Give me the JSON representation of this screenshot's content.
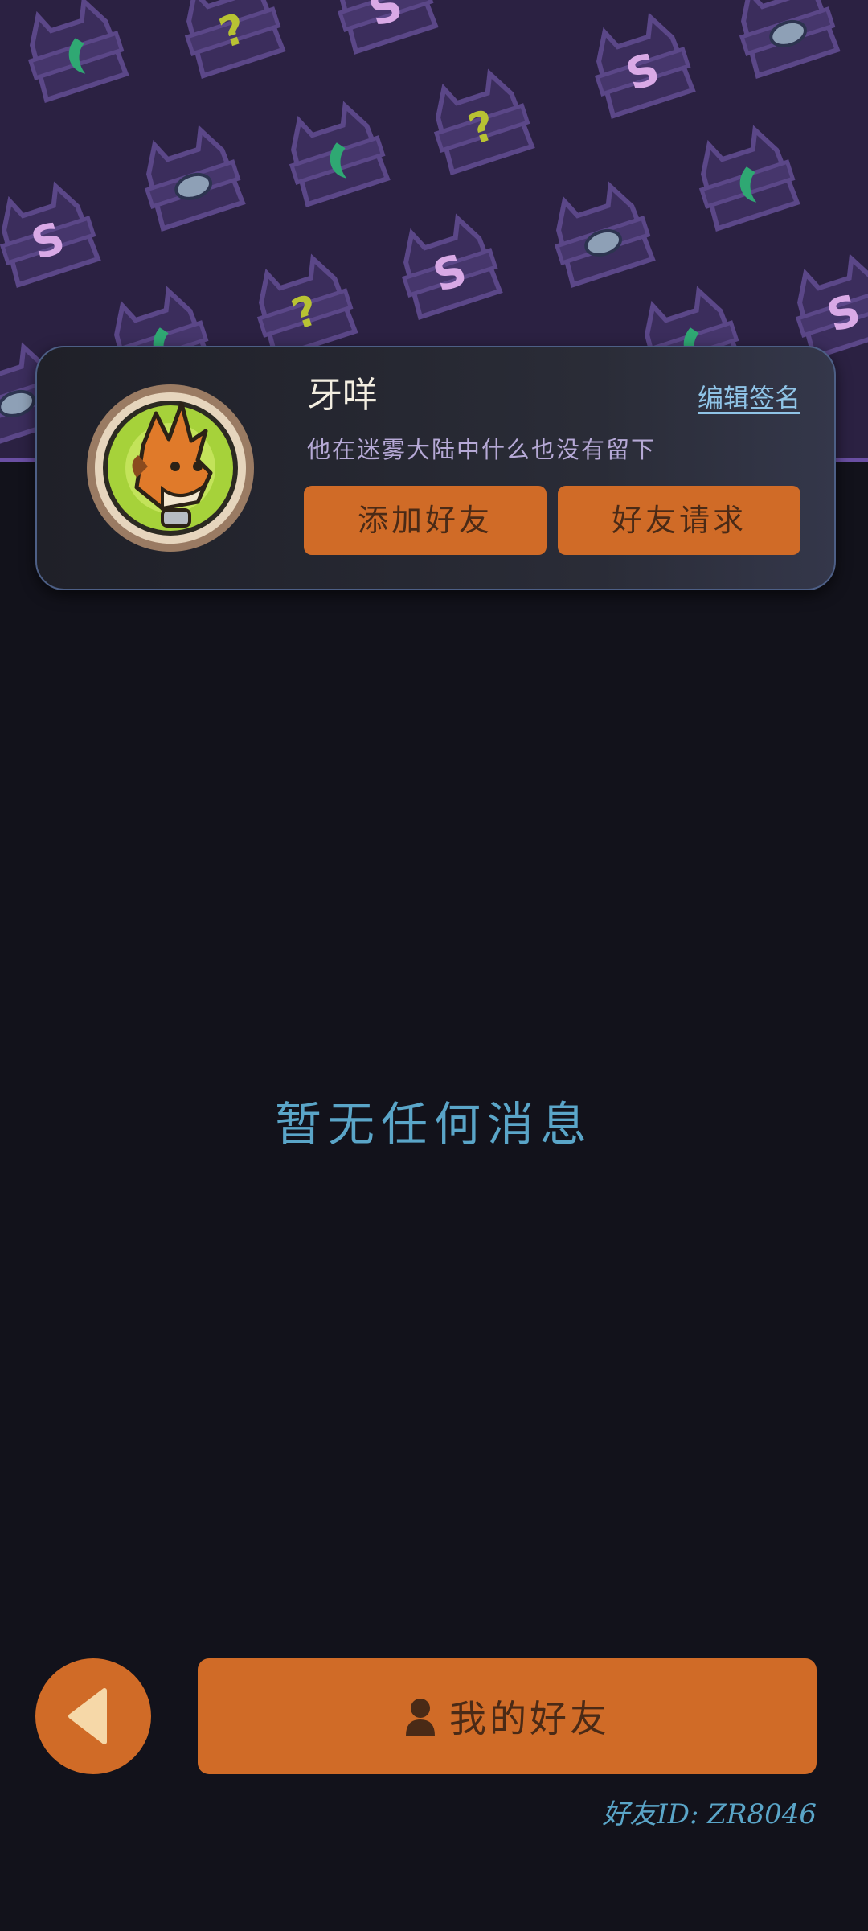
{
  "profile": {
    "nickname": "牙咩",
    "edit_signature_label": "编辑签名",
    "signature": "他在迷雾大陆中什么也没有留下",
    "add_friend_label": "添加好友",
    "friend_requests_label": "好友请求"
  },
  "messages": {
    "empty_text": "暂无任何消息"
  },
  "bottom_bar": {
    "my_friends_label": "我的好友",
    "friend_id_text": "好友ID: ZR8046"
  },
  "colors": {
    "accent_orange": "#d06b27",
    "background": "#12121b",
    "banner_purple": "#2b2142",
    "link_blue": "#8fc3e6"
  },
  "icons": {
    "back": "back-arrow-icon",
    "friends": "person-icon"
  }
}
